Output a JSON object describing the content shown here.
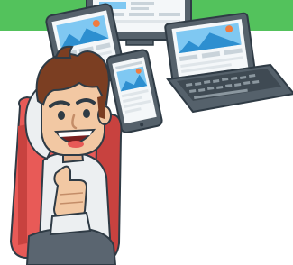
{
  "illustration": {
    "subject": "happy-man-thumbs-up-with-responsive-devices",
    "devices": [
      "desktop-monitor",
      "tablet",
      "smartphone",
      "laptop"
    ]
  },
  "colors": {
    "banner_green": "#53c25c",
    "outline": "#2f3b45",
    "device_dark": "#55616b",
    "device_light": "#e8ecef",
    "screen_bg": "#f4f7f9",
    "sky_blue": "#7fc8f2",
    "mountain_blue": "#2d8fd0",
    "sun_orange": "#f07b3f",
    "chair_red": "#e85a57",
    "chair_dark": "#c8423f",
    "skin": "#f2c8a3",
    "hair": "#7b3e22",
    "shirt": "#eceff1",
    "pants": "#5a6570"
  }
}
